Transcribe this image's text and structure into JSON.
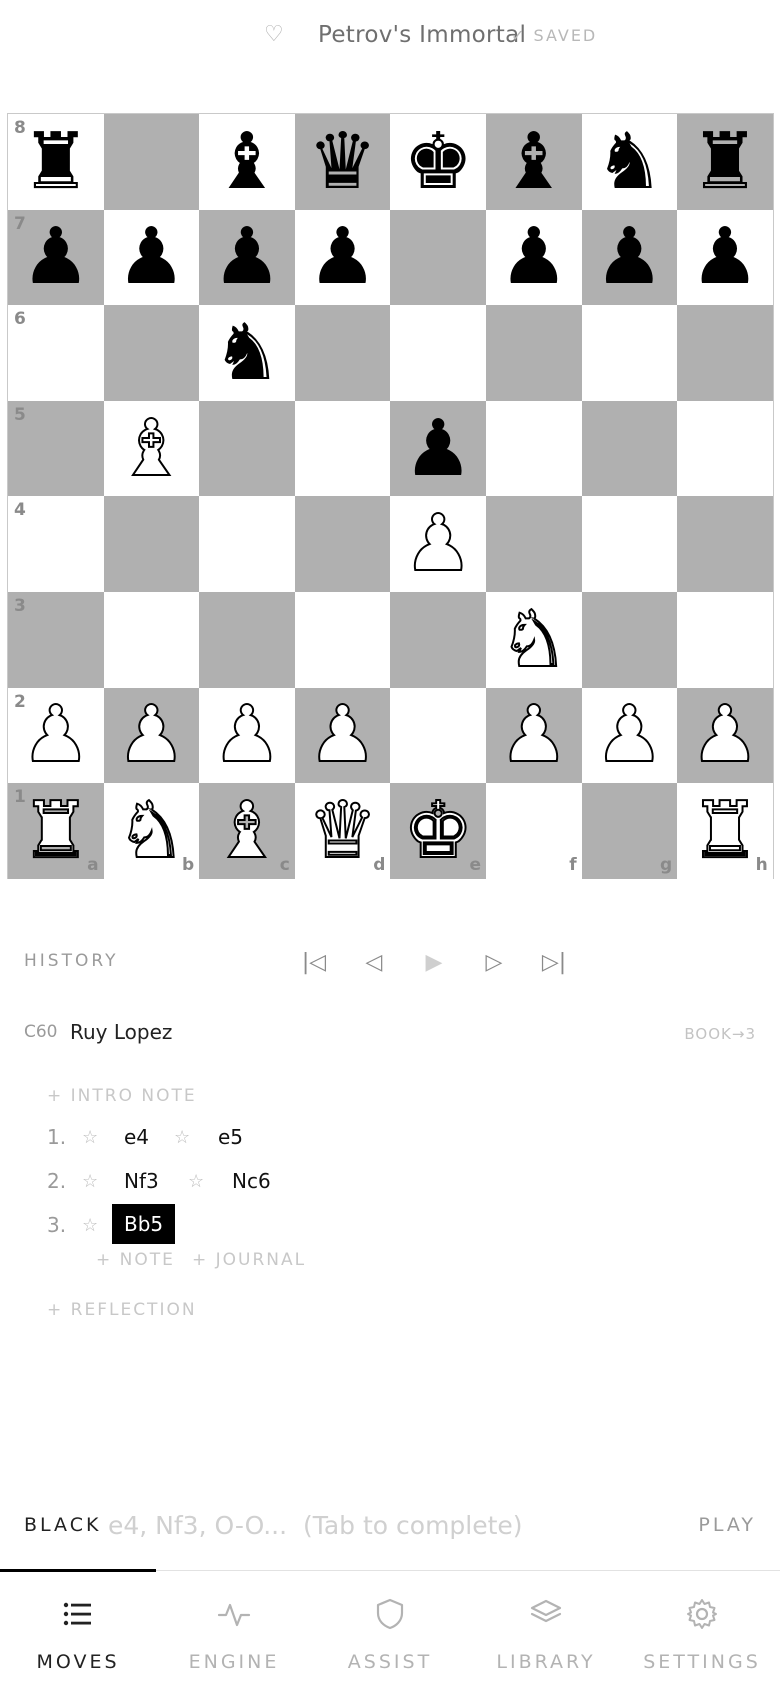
{
  "header": {
    "favorite_icon": "heart-outline-icon",
    "title": "Petrov's Immortal",
    "saved_label": "✓ SAVED"
  },
  "board": {
    "orientation": "white",
    "files": [
      "a",
      "b",
      "c",
      "d",
      "e",
      "f",
      "g",
      "h"
    ],
    "ranks": [
      "8",
      "7",
      "6",
      "5",
      "4",
      "3",
      "2",
      "1"
    ],
    "light_color": "#ffffff",
    "dark_color": "#b0b0b0",
    "position": [
      [
        "br",
        "",
        "bb",
        "bq",
        "bk",
        "bb",
        "bn",
        "br"
      ],
      [
        "bp",
        "bp",
        "bp",
        "bp",
        "",
        "bp",
        "bp",
        "bp"
      ],
      [
        "",
        "",
        "bn",
        "",
        "",
        "",
        "",
        ""
      ],
      [
        "",
        "wb",
        "",
        "",
        "bp",
        "",
        "",
        ""
      ],
      [
        "",
        "",
        "",
        "",
        "wp",
        "",
        "",
        ""
      ],
      [
        "",
        "",
        "",
        "",
        "",
        "wn",
        "",
        ""
      ],
      [
        "wp",
        "wp",
        "wp",
        "wp",
        "",
        "wp",
        "wp",
        "wp"
      ],
      [
        "wr",
        "wn",
        "wb",
        "wq",
        "wk",
        "",
        "",
        "wr"
      ]
    ]
  },
  "history": {
    "label": "HISTORY",
    "nav": [
      {
        "name": "first-move-button",
        "glyph": "|◁",
        "disabled": false
      },
      {
        "name": "previous-move-button",
        "glyph": "◁",
        "disabled": false
      },
      {
        "name": "play-moves-button",
        "glyph": "▶",
        "disabled": true
      },
      {
        "name": "next-move-button",
        "glyph": "▷",
        "disabled": false
      },
      {
        "name": "last-move-button",
        "glyph": "▷|",
        "disabled": false
      }
    ]
  },
  "opening": {
    "eco": "C60",
    "name": "Ruy Lopez",
    "book": "BOOK→3"
  },
  "notes": {
    "intro": "+ INTRO NOTE",
    "note": "+ NOTE",
    "journal": "+ JOURNAL",
    "reflection": "+ REFLECTION"
  },
  "moves": [
    {
      "num": "1.",
      "white": "e4",
      "black": "e5"
    },
    {
      "num": "2.",
      "white": "Nf3",
      "black": "Nc6"
    },
    {
      "num": "3.",
      "white": "Bb5",
      "black": ""
    }
  ],
  "star_glyph": "☆",
  "input_bar": {
    "side_to_move": "BLACK",
    "placeholder": "e4, Nf3, O-O...  (Tab to complete)",
    "value": "",
    "play_label": "PLAY"
  },
  "tabs": [
    {
      "label": "MOVES",
      "icon": "list-icon",
      "active": true
    },
    {
      "label": "ENGINE",
      "icon": "activity-icon",
      "active": false
    },
    {
      "label": "ASSIST",
      "icon": "shield-icon",
      "active": false
    },
    {
      "label": "LIBRARY",
      "icon": "layers-icon",
      "active": false
    },
    {
      "label": "SETTINGS",
      "icon": "gear-icon",
      "active": false
    }
  ]
}
